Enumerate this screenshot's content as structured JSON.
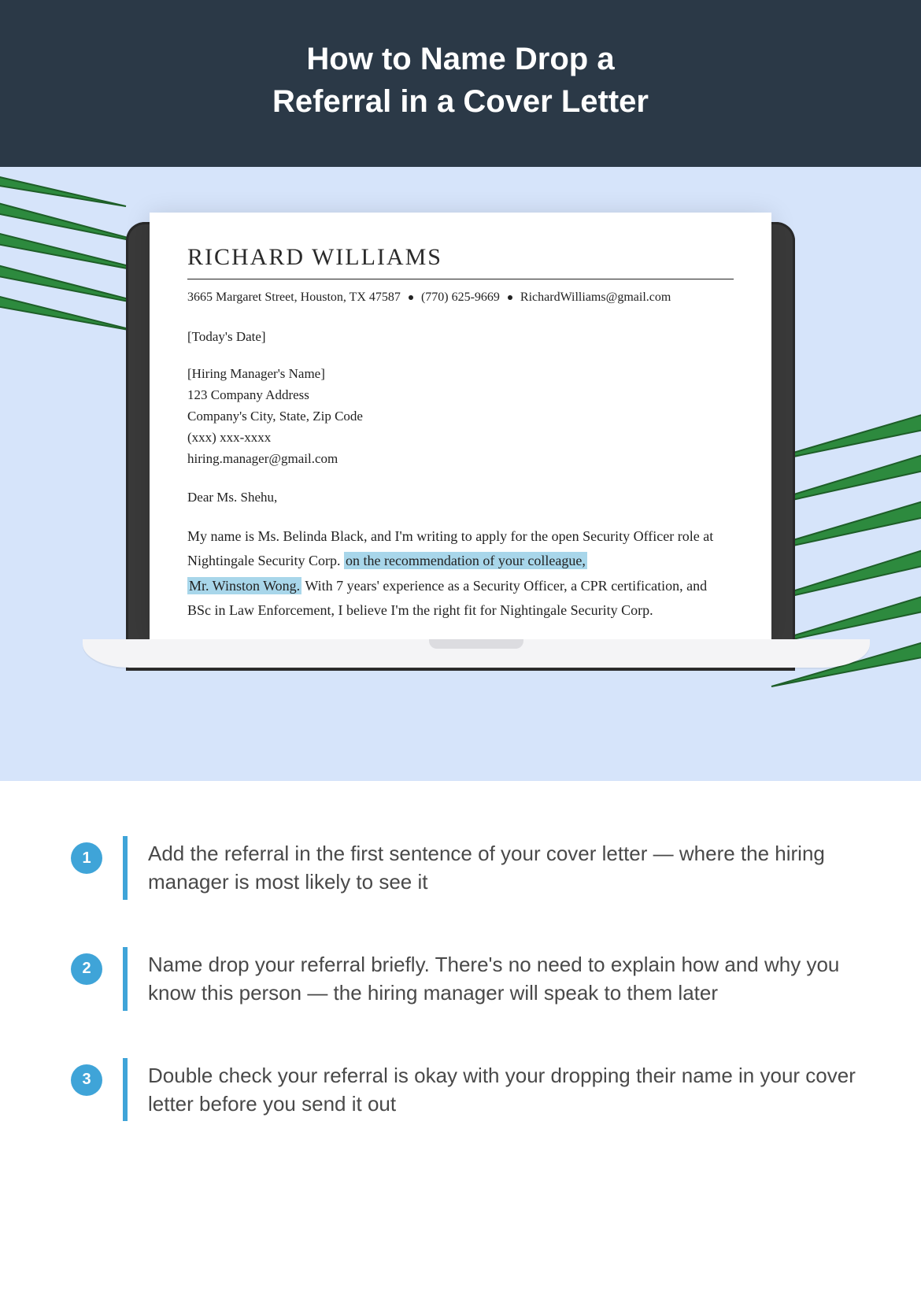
{
  "header": {
    "title_line1": "How to Name Drop a",
    "title_line2": "Referral in a Cover Letter"
  },
  "letter": {
    "name": "RICHARD WILLIAMS",
    "address": "3665 Margaret Street, Houston, TX 47587",
    "phone": "(770) 625-9669",
    "email": "RichardWilliams@gmail.com",
    "date": "[Today's Date]",
    "recipient": {
      "name": "[Hiring Manager's Name]",
      "addr1": "123 Company Address",
      "addr2": "Company's City, State, Zip Code",
      "phone": "(xxx) xxx-xxxx",
      "email": "hiring.manager@gmail.com"
    },
    "salutation": "Dear Ms. Shehu,",
    "body_pre": "My name is Ms. Belinda Black, and I'm writing to apply for the open Security Officer role at Nightingale Security Corp. ",
    "body_hl1": "on the recommendation of your colleague,",
    "body_hl2": "Mr. Winston Wong.",
    "body_post": " With 7 years' experience as a Security Officer, a CPR certification, and BSc in Law Enforcement, I believe I'm the right fit for Nightingale Security Corp."
  },
  "tips": [
    {
      "num": "1",
      "text": "Add the referral in the first sentence of your cover letter — where the hiring manager is most likely to see it"
    },
    {
      "num": "2",
      "text": "Name drop your referral briefly. There's no need to explain how and why you know this person — the hiring manager will speak to them later"
    },
    {
      "num": "3",
      "text": "Double check your referral is okay with your dropping their name in your cover letter before you send it out"
    }
  ]
}
